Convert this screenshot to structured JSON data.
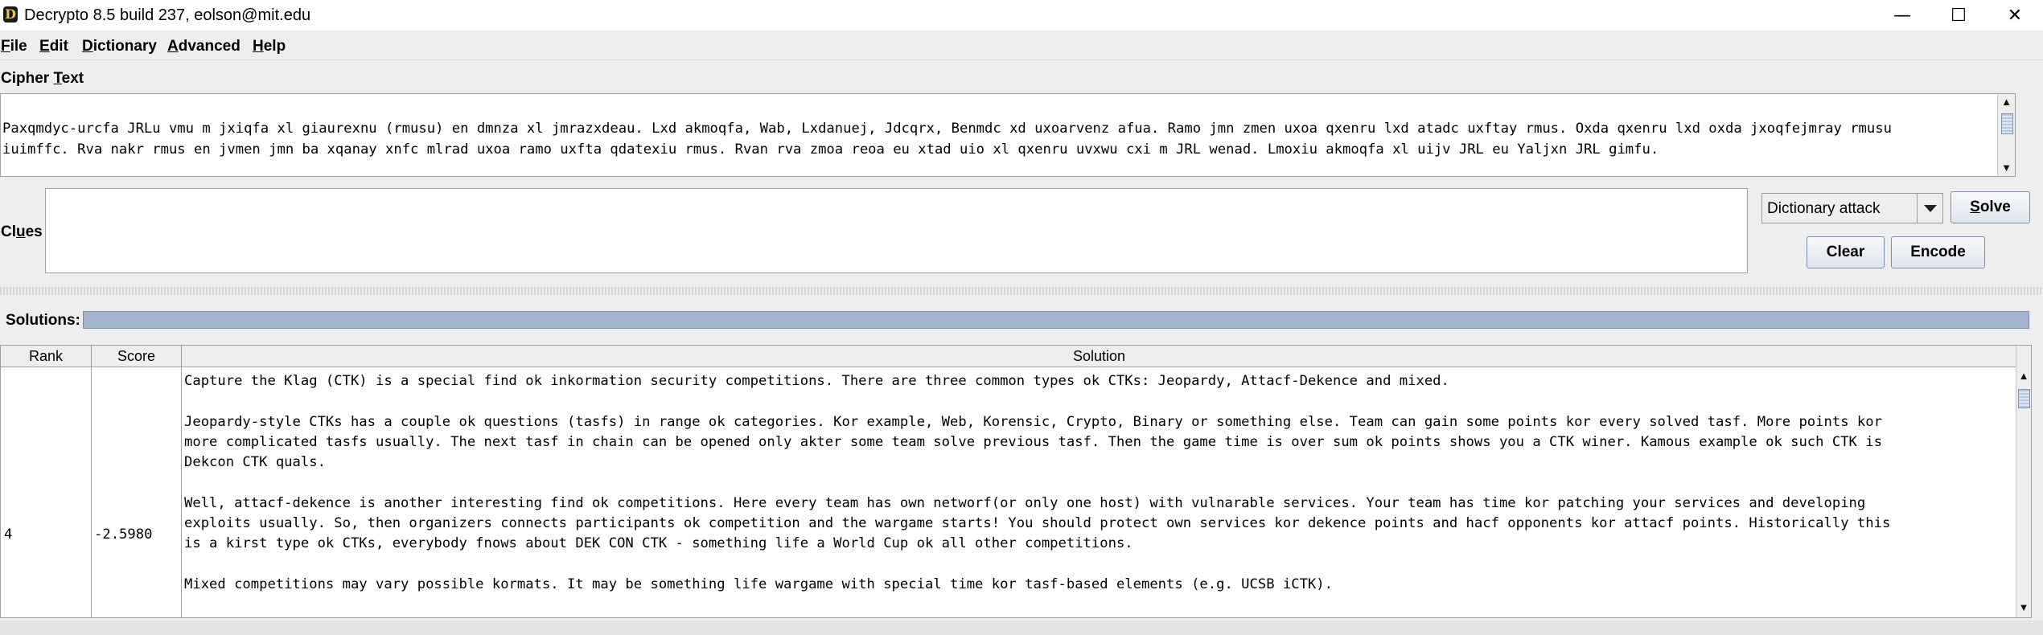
{
  "window": {
    "title": "Decrypto 8.5 build 237, eolson@mit.edu",
    "icon_letter": "D",
    "controls": {
      "minimize": "—",
      "maximize": "☐",
      "close": "✕"
    }
  },
  "menu": {
    "file": {
      "mn": "F",
      "rest": "ile"
    },
    "edit": {
      "mn": "E",
      "rest": "dit"
    },
    "dictionary": {
      "mn": "D",
      "rest": "ictionary"
    },
    "advanced": {
      "mn": "A",
      "rest": "dvanced"
    },
    "help": {
      "mn": "H",
      "rest": "elp"
    }
  },
  "cipher": {
    "label_pre": "Cipher ",
    "label_mn": "T",
    "label_post": "ext",
    "lines": [
      "Paxqmdyc-urcfa JRLu vmu m jxiqfa xl giaurexnu (rmusu) en dmnza xl jmrazxdeau. Lxd akmoqfa, Wab, Lxdanuej, Jdcqrx, Benmdc xd uxoarvenz afua. Ramo jmn zmen uxoa qxenru lxd atadc uxftay rmus. Oxda qxenru lxd oxda jxoqfejmray rmusu",
      "iuimffc. Rva nakr rmus en jvmen jmn ba xqanay xnfc mlrad uxoa ramo uxfta qdatexiu rmus. Rvan rva zmoa reoa eu xtad uio xl qxenru uvxwu cxi m JRL wenad. Lmoxiu akmoqfa xl uijv JRL eu Yaljxn JRL gimfu."
    ]
  },
  "clues": {
    "label_pre": "Cl",
    "label_mn": "u",
    "label_post": "es",
    "value": ""
  },
  "controls": {
    "mode_select": "Dictionary attack",
    "solve_mn": "S",
    "solve_rest": "olve",
    "clear": "Clear",
    "encode": "Encode"
  },
  "solutions": {
    "label": "Solutions:",
    "progress": 1.0,
    "columns": [
      "Rank",
      "Score",
      "Solution"
    ],
    "rows": [
      {
        "rank": "4",
        "score": "-2.5980",
        "lines": [
          "Capture the Klag (CTK) is a special find ok inkormation security competitions. There are three common types ok CTKs: Jeopardy, Attacf-Dekence and mixed.",
          "",
          "Jeopardy-style CTKs has a couple ok questions (tasfs) in range ok categories. Kor example, Web, Korensic, Crypto, Binary or something else. Team can gain some points kor every solved tasf. More points kor",
          "more complicated tasfs usually. The next tasf in chain can be opened only akter some team solve previous tasf. Then the game time is over sum ok points shows you a CTK winer. Kamous example ok such CTK is",
          "Dekcon CTK quals.",
          "",
          "Well, attacf-dekence is another interesting find ok competitions. Here every team has own networf(or only one host) with vulnarable services. Your team has time kor patching your services and developing",
          "exploits usually. So, then organizers connects participants ok competition and the wargame starts! You should protect own services kor dekence points and hacf opponents kor attacf points. Historically this",
          "is a kirst type ok CTKs, everybody fnows about DEK CON CTK - something life a World Cup ok all other competitions.",
          "",
          "Mixed competitions may vary possible kormats. It may be something life wargame with special time kor tasf-based elements (e.g. UCSB iCTK)."
        ]
      }
    ]
  }
}
